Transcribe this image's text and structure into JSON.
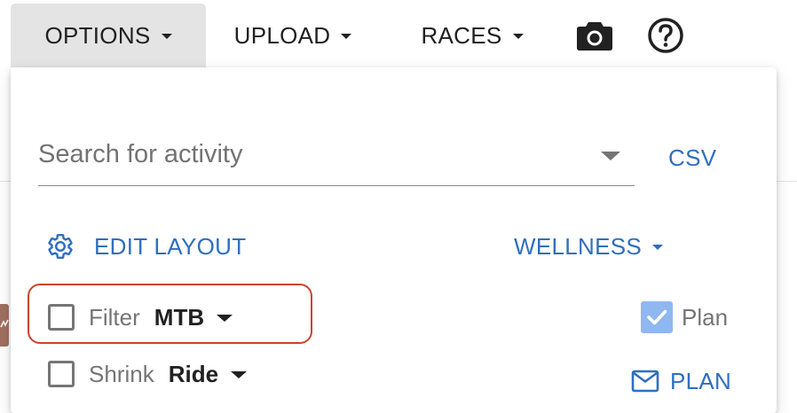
{
  "toolbar": {
    "options_label": "OPTIONS",
    "upload_label": "UPLOAD",
    "races_label": "RACES"
  },
  "panel": {
    "search": {
      "placeholder": "Search for activity",
      "value": ""
    },
    "csv_label": "CSV",
    "edit_layout_label": "EDIT LAYOUT",
    "wellness_label": "WELLNESS",
    "filter_row": {
      "checkbox_label": "Filter",
      "selected_value": "MTB",
      "checked": false
    },
    "shrink_row": {
      "checkbox_label": "Shrink",
      "selected_value": "Ride",
      "checked": false
    },
    "plan_checkbox": {
      "label": "Plan",
      "checked": true
    },
    "plan_button_label": "PLAN"
  },
  "colors": {
    "accent": "#2f6fbf",
    "checkbox_checked": "#8fb8f0",
    "highlight": "#c9442f",
    "active_menu_bg": "#e4e4e4"
  },
  "icons": {
    "camera": "camera-icon",
    "help": "help-circle-icon",
    "gear": "gear-icon",
    "mail": "mail-icon"
  }
}
